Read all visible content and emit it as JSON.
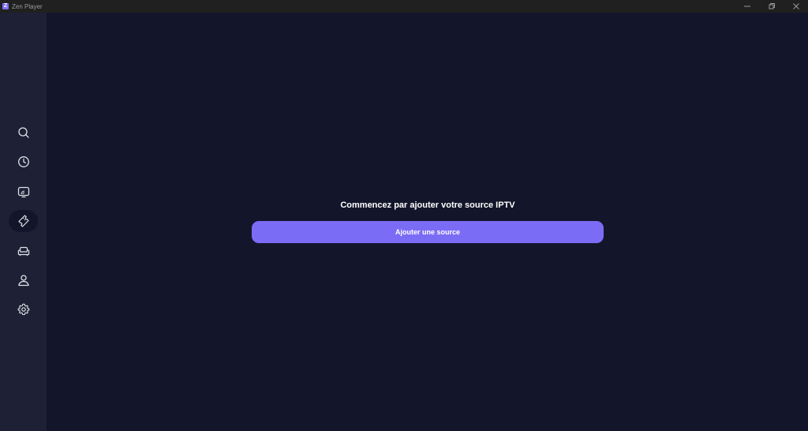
{
  "window": {
    "title": "Zen Player",
    "logo_letter": "Z"
  },
  "sidebar": {
    "items": [
      {
        "icon": "search-icon",
        "active": false
      },
      {
        "icon": "clock-icon",
        "active": false
      },
      {
        "icon": "live-tv-icon",
        "active": false
      },
      {
        "icon": "ticket-icon",
        "active": true
      },
      {
        "icon": "sofa-icon",
        "active": false
      },
      {
        "icon": "user-icon",
        "active": false
      },
      {
        "icon": "gear-icon",
        "active": false
      }
    ]
  },
  "main": {
    "headline": "Commencez par ajouter votre source IPTV",
    "cta_label": "Ajouter une source"
  },
  "colors": {
    "accent": "#7b6cf6",
    "background": "#13162a",
    "sidebar": "#1e2036",
    "titlebar": "#202020"
  }
}
